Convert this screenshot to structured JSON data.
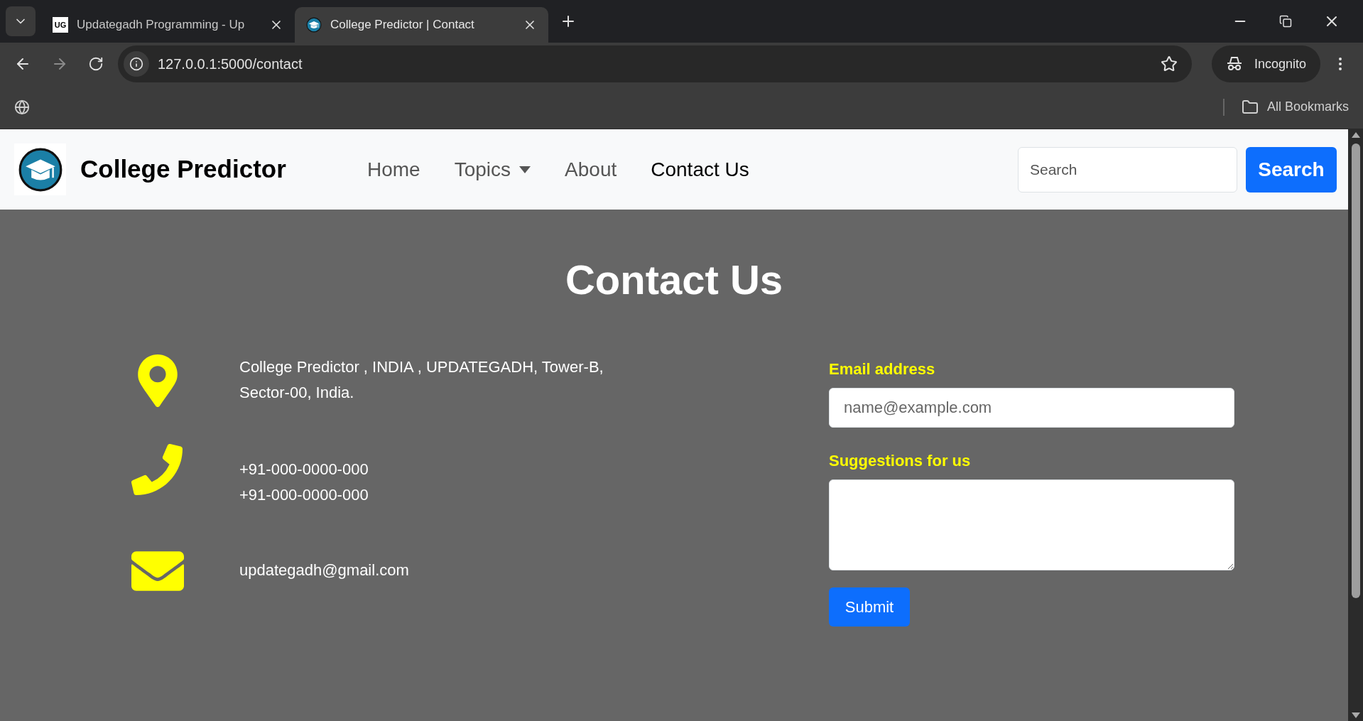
{
  "browser": {
    "tabs": [
      {
        "title": "Updategadh Programming - Up",
        "favicon_text": "UG",
        "kind": "text-logo",
        "selected": false
      },
      {
        "title": "College Predictor | Contact",
        "kind": "cap-logo",
        "selected": true
      }
    ],
    "address": "127.0.0.1:5000/contact",
    "profile": "Incognito",
    "bookmarks": "All Bookmarks"
  },
  "navbar": {
    "brand": "College Predictor",
    "links": [
      {
        "label": "Home",
        "kind": "link",
        "selected": false
      },
      {
        "label": "Topics",
        "kind": "dropdown",
        "selected": false
      },
      {
        "label": "About",
        "kind": "link",
        "selected": false
      },
      {
        "label": "Contact Us",
        "kind": "link",
        "selected": true
      }
    ],
    "search": {
      "placeholder": "Search"
    },
    "search_button": "Search"
  },
  "contact": {
    "heading": "Contact Us",
    "items": [
      {
        "kind": "address",
        "lines": [
          "College Predictor , INDIA , UPDATEGADH, Tower-B,",
          "Sector-00, India."
        ]
      },
      {
        "kind": "phone",
        "lines": [
          "+91-000-0000-000",
          "+91-000-0000-000"
        ]
      },
      {
        "kind": "email",
        "lines": [
          "updategadh@gmail.com"
        ]
      }
    ],
    "form": {
      "email_label": "Email address",
      "email_placeholder": "name@example.com",
      "suggestions_label": "Suggestions for us",
      "submit": "Submit"
    }
  }
}
